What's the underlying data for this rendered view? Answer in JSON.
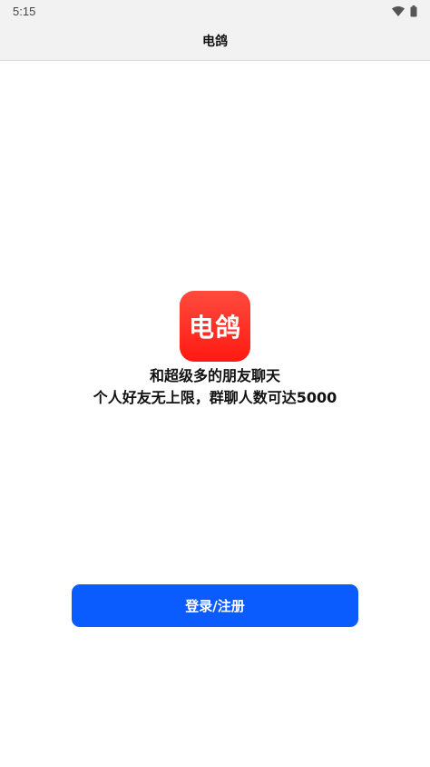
{
  "status_bar": {
    "time": "5:15",
    "icons": [
      "wifi-icon",
      "battery-icon"
    ]
  },
  "app_bar": {
    "title": "电鸽"
  },
  "hero": {
    "logo_text": "电鸽",
    "logo_color": "#ff2a1f",
    "tagline_line1": "和超级多的朋友聊天",
    "tagline_line2": "个人好友无上限，群聊人数可达5000"
  },
  "actions": {
    "login_label": "登录/注册",
    "accent_color": "#0a5cff"
  }
}
